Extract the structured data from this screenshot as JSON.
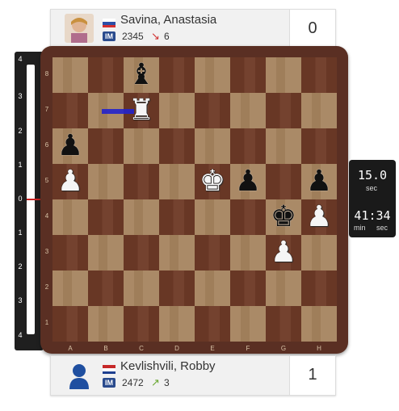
{
  "top_player": {
    "name": "Savina, Anastasia",
    "title": "IM",
    "rating": "2345",
    "delta": "6",
    "score": "0",
    "flag": "russia",
    "delta_direction": "down"
  },
  "bottom_player": {
    "name": "Kevlishvili, Robby",
    "title": "IM",
    "rating": "2472",
    "delta": "3",
    "score": "1",
    "flag": "netherlands",
    "delta_direction": "up"
  },
  "eval_bar": {
    "ticks": [
      "4",
      "3",
      "2",
      "1",
      "0",
      "1",
      "2",
      "3",
      "4"
    ],
    "value": 0
  },
  "board": {
    "ranks": [
      "8",
      "7",
      "6",
      "5",
      "4",
      "3",
      "2",
      "1"
    ],
    "files": [
      "A",
      "B",
      "C",
      "D",
      "E",
      "F",
      "G",
      "H"
    ],
    "pieces": [
      {
        "square": "c8",
        "piece": "bishop",
        "color": "black"
      },
      {
        "square": "c7",
        "piece": "rook",
        "color": "white"
      },
      {
        "square": "a6",
        "piece": "pawn",
        "color": "black"
      },
      {
        "square": "a5",
        "piece": "pawn",
        "color": "white"
      },
      {
        "square": "e5",
        "piece": "king",
        "color": "white"
      },
      {
        "square": "f5",
        "piece": "pawn",
        "color": "black"
      },
      {
        "square": "h5",
        "piece": "pawn",
        "color": "black"
      },
      {
        "square": "g4",
        "piece": "king",
        "color": "black"
      },
      {
        "square": "h4",
        "piece": "pawn",
        "color": "white"
      },
      {
        "square": "g3",
        "piece": "pawn",
        "color": "white"
      }
    ],
    "last_move_arrow": {
      "from": "b7",
      "to": "c7"
    }
  },
  "clock": {
    "increment": "15.0",
    "increment_unit": "sec",
    "time": "41:34",
    "time_unit_min": "min",
    "time_unit_sec": "sec"
  }
}
